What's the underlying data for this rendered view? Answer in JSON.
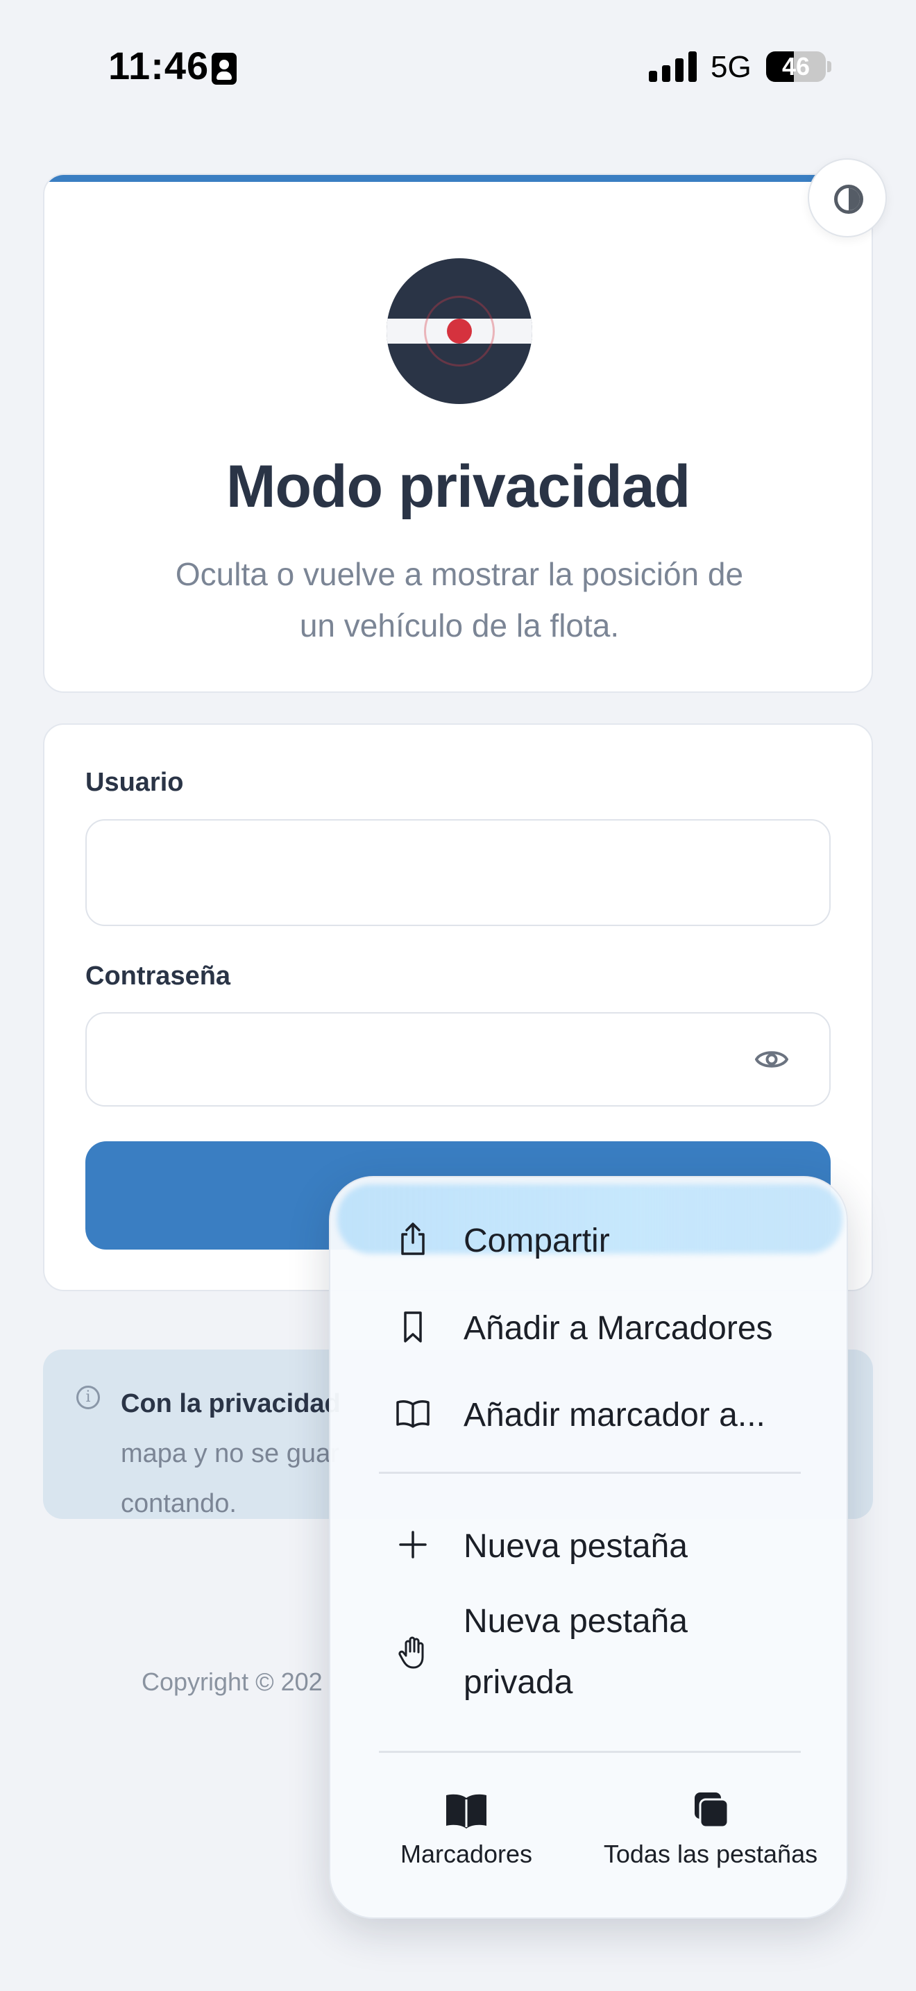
{
  "status_bar": {
    "time": "11:46",
    "network": "5G",
    "battery_level": "46",
    "battery_fraction": 0.46,
    "icons": [
      "id-card-icon",
      "cellular-signal-icon",
      "battery-icon"
    ]
  },
  "header": {
    "title": "Modo privacidad",
    "subtitle": "Oculta o vuelve a mostrar la posición de un vehículo de la flota.",
    "theme_toggle_icon": "contrast-icon",
    "accent_color": "#3a7ec2"
  },
  "login": {
    "username_label": "Usuario",
    "username_value": "",
    "password_label": "Contraseña",
    "password_value": "",
    "show_password_icon": "eye-icon",
    "submit_color": "#3a7ec2"
  },
  "info": {
    "icon": "info-icon",
    "strong": "Con la privacidad",
    "line2": "mapa y no se guar",
    "line3": "contando."
  },
  "footer": {
    "copyright": "Copyright © 202"
  },
  "context_menu": {
    "items": [
      {
        "label": "Compartir",
        "icon": "share-icon"
      },
      {
        "label": "Añadir a Marcadores",
        "icon": "bookmark-icon"
      },
      {
        "label": "Añadir marcador a...",
        "icon": "book-open-icon"
      },
      {
        "label": "Nueva pestaña",
        "icon": "plus-icon"
      },
      {
        "label_line1": "Nueva pestaña",
        "label_line2": "privada",
        "icon": "hand-icon"
      }
    ],
    "bottom": [
      {
        "label": "Marcadores",
        "icon": "bookmarks-book-icon"
      },
      {
        "label": "Todas las pestañas",
        "icon": "tabs-icon"
      }
    ]
  }
}
